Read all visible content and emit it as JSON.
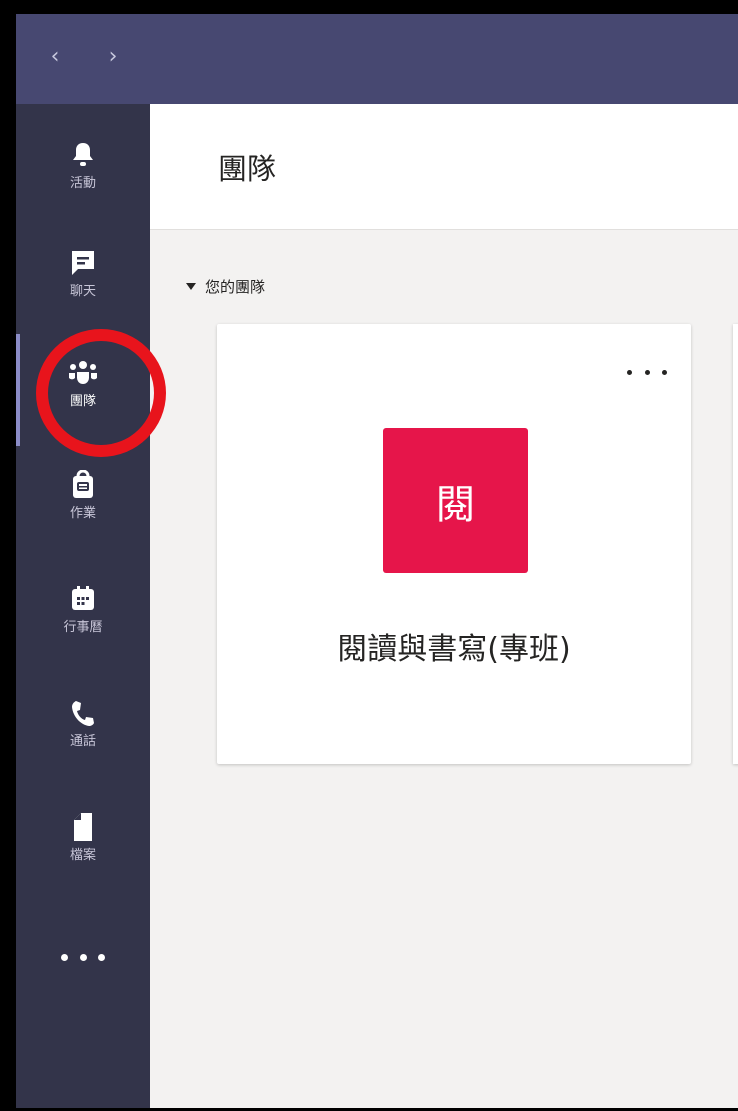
{
  "titlebar": {
    "back_glyph": "‹",
    "forward_glyph": "›"
  },
  "sidebar": {
    "items": [
      {
        "label": "活動",
        "icon": "bell-icon"
      },
      {
        "label": "聊天",
        "icon": "chat-icon"
      },
      {
        "label": "團隊",
        "icon": "teams-icon",
        "active": true
      },
      {
        "label": "作業",
        "icon": "assignments-icon"
      },
      {
        "label": "行事曆",
        "icon": "calendar-icon"
      },
      {
        "label": "通話",
        "icon": "phone-icon"
      },
      {
        "label": "檔案",
        "icon": "files-icon"
      }
    ]
  },
  "main": {
    "title": "團隊",
    "section_label": "您的團隊",
    "team": {
      "avatar_text": "閱",
      "name": "閱讀與書寫(專班)",
      "avatar_color": "#e6154a"
    }
  },
  "colors": {
    "titlebar": "#474871",
    "sidebar": "#33344a",
    "highlight_circle": "#e8141c"
  }
}
